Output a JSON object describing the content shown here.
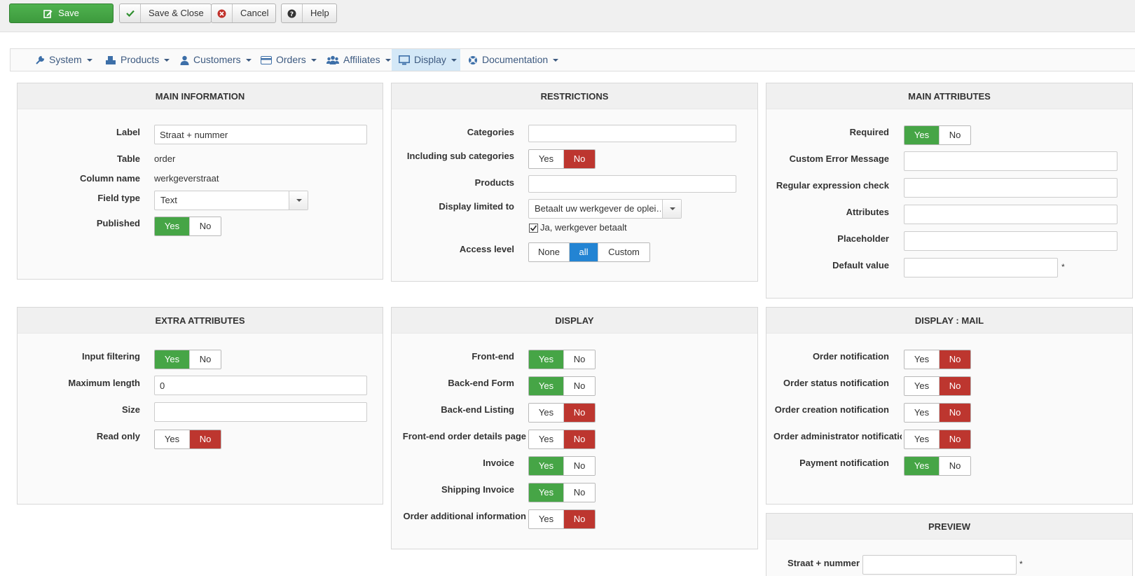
{
  "toolbar": {
    "save": "Save",
    "save_close": "Save & Close",
    "cancel": "Cancel",
    "help": "Help"
  },
  "menu": {
    "system": "System",
    "products": "Products",
    "customers": "Customers",
    "orders": "Orders",
    "affiliates": "Affiliates",
    "display": "Display",
    "documentation": "Documentation"
  },
  "toggle": {
    "yes": "Yes",
    "no": "No",
    "none": "None",
    "all": "all",
    "custom": "Custom"
  },
  "main_info": {
    "title": "MAIN INFORMATION",
    "label_label": "Label",
    "label_value": "Straat + nummer",
    "table_label": "Table",
    "table_value": "order",
    "column_label": "Column name",
    "column_value": "werkgeverstraat",
    "fieldtype_label": "Field type",
    "fieldtype_value": "Text",
    "published_label": "Published",
    "published": "yes"
  },
  "restrictions": {
    "title": "RESTRICTIONS",
    "categories_label": "Categories",
    "sub_label": "Including sub categories",
    "sub": "no",
    "products_label": "Products",
    "display_limited_label": "Display limited to",
    "display_limited_value": "Betaalt uw werkgever de oplei…",
    "checkbox_label": "Ja, werkgever betaalt",
    "checkbox_checked": true,
    "access_label": "Access level",
    "access": "all"
  },
  "main_attr": {
    "title": "MAIN ATTRIBUTES",
    "required_label": "Required",
    "required": "yes",
    "error_label": "Custom Error Message",
    "regex_label": "Regular expression check",
    "attributes_label": "Attributes",
    "placeholder_label": "Placeholder",
    "default_label": "Default value",
    "star": "*"
  },
  "extra_attr": {
    "title": "EXTRA ATTRIBUTES",
    "filter_label": "Input filtering",
    "filter": "yes",
    "maxlen_label": "Maximum length",
    "maxlen_value": "0",
    "size_label": "Size",
    "readonly_label": "Read only",
    "readonly": "no"
  },
  "display": {
    "title": "DISPLAY",
    "frontend_label": "Front-end",
    "frontend": "yes",
    "backform_label": "Back-end Form",
    "backform": "yes",
    "backlist_label": "Back-end Listing",
    "backlist": "no",
    "fedetails_label": "Front-end order details page",
    "fedetails": "no",
    "invoice_label": "Invoice",
    "invoice": "yes",
    "shipinv_label": "Shipping Invoice",
    "shipinv": "yes",
    "addinfo_label": "Order additional information",
    "addinfo": "no"
  },
  "display_mail": {
    "title": "DISPLAY : MAIL",
    "ordernotif_label": "Order notification",
    "ordernotif": "no",
    "statusnotif_label": "Order status notification",
    "statusnotif": "no",
    "creationnotif_label": "Order creation notification",
    "creationnotif": "no",
    "adminnotif_label": "Order administrator notification",
    "adminnotif": "no",
    "paymentnotif_label": "Payment notification",
    "paymentnotif": "yes"
  },
  "preview": {
    "title": "PREVIEW",
    "field_label": "Straat + nummer",
    "star": "*"
  },
  "colors": {
    "yes": "#46a546",
    "no": "#bd362f",
    "all": "#2384d3",
    "menu_active": "#d4e8f7"
  }
}
